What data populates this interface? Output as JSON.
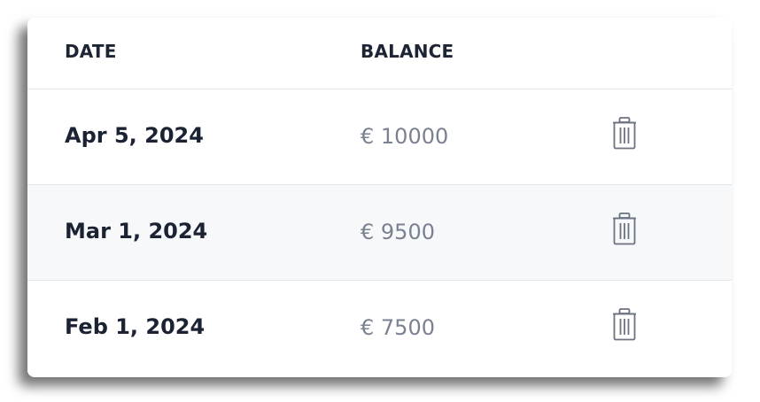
{
  "table": {
    "headers": {
      "date": "DATE",
      "balance": "BALANCE"
    },
    "rows": [
      {
        "date": "Apr 5, 2024",
        "balance": "€ 10000",
        "action_icon": "trash-icon"
      },
      {
        "date": "Mar 1, 2024",
        "balance": "€ 9500",
        "action_icon": "trash-icon"
      },
      {
        "date": "Feb 1, 2024",
        "balance": "€ 7500",
        "action_icon": "trash-icon"
      }
    ]
  },
  "colors": {
    "header_text": "#1d2433",
    "date_text": "#1b2232",
    "balance_text": "#7a8190",
    "row_alt_bg": "#f6f8fa",
    "divider": "#e3e6ea",
    "icon": "#6b7280"
  }
}
